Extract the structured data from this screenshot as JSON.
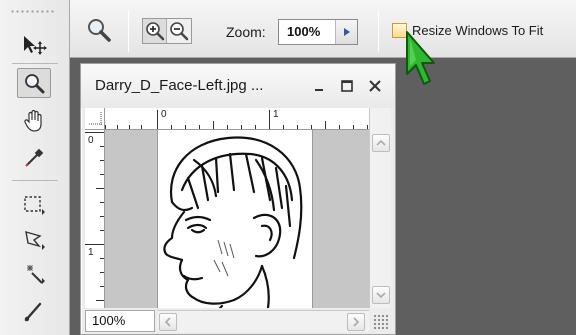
{
  "options_bar": {
    "zoom_label": "Zoom:",
    "zoom_value": "100%",
    "resize_windows_label": "Resize Windows To Fit",
    "resize_windows_checked": false
  },
  "tools": [
    {
      "name": "move-tool",
      "icon": "move-icon",
      "active": false
    },
    {
      "name": "zoom-tool",
      "icon": "magnifier-icon",
      "active": true
    },
    {
      "name": "hand-tool",
      "icon": "hand-icon",
      "active": false
    },
    {
      "name": "eyedropper-tool",
      "icon": "eyedropper-icon",
      "active": false
    },
    {
      "name": "marquee-tool",
      "icon": "marquee-icon",
      "active": false
    },
    {
      "name": "lasso-tool",
      "icon": "lasso-icon",
      "active": false
    },
    {
      "name": "magic-wand-tool",
      "icon": "magic-wand-icon",
      "active": false
    },
    {
      "name": "brush-tool",
      "icon": "brush-icon",
      "active": false
    }
  ],
  "document": {
    "title": "Darry_D_Face-Left.jpg ...",
    "ruler_h_labels": [
      "0",
      "1"
    ],
    "ruler_v_labels": [
      "0",
      "1"
    ],
    "zoom_status": "100%"
  },
  "colors": {
    "workspace": "#5f5f5f",
    "panel": "#ececec",
    "checkbox_accent": "#ffd98a",
    "cursor_fill": "#2fb82f"
  }
}
